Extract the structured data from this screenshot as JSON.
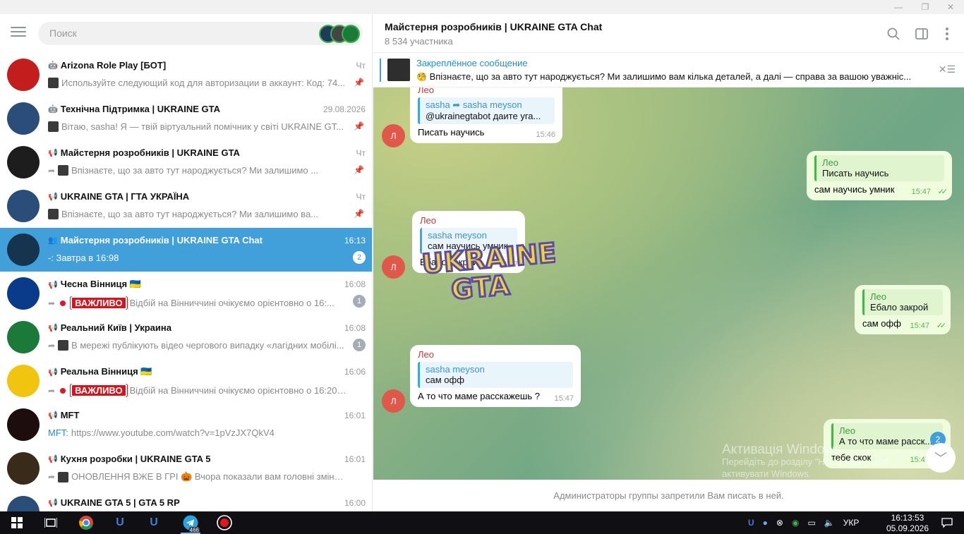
{
  "window": {
    "controls": {
      "minimize": "—",
      "maximize": "❐",
      "close": "✕"
    }
  },
  "sidebar": {
    "search_placeholder": "Поиск",
    "chats": [
      {
        "title": "Arizona Role Play [БОТ]",
        "kind": "bot",
        "time": "Чт",
        "preview": "Используйте следующий код для авторизации в аккаунт: Код: 74...",
        "pinned": true,
        "avatar_color": "#c31d1d"
      },
      {
        "title": "Технічна Підтримка | UKRAINE GTA",
        "kind": "bot",
        "time": "29.08.2026",
        "preview": "Вітаю, sasha! Я — твій віртуальний помічник у світі UKRAINE GT...",
        "pinned": true,
        "avatar_color": "#2a4d7a"
      },
      {
        "title": "Майстерня розробників | UKRAINE GTA",
        "kind": "channel",
        "time": "Чт",
        "preview": "Впізнаєте, що за авто тут народжується?  Ми залишимо ...",
        "pinned": true,
        "avatar_color": "#1d1d1d"
      },
      {
        "title": "UKRAINE GTA | ГТА УКРАЇНА",
        "kind": "channel",
        "time": "Чт",
        "preview": "Впізнаєте, що за авто тут народжується?  Ми залишимо ва...",
        "pinned": true,
        "avatar_color": "#2a4d7a"
      },
      {
        "title": "Майстерня розробників | UKRAINE GTA Chat",
        "kind": "group",
        "time": "16:13",
        "preview": "-: Завтра в 16:98",
        "badge": "2",
        "active": true,
        "avatar_color": "#17344f"
      },
      {
        "title": "Чесна Вінниця 🇺🇦",
        "kind": "channel",
        "time": "16:08",
        "tag": "ВАЖЛИВО",
        "preview": "Відбій на Вінниччині очікуємо орієнтовно о 16:...",
        "badge": "1",
        "avatar_color": "#0a3a8a"
      },
      {
        "title": "Реальний Київ | Украина",
        "kind": "channel",
        "time": "16:08",
        "preview": "В мережі публікують відео чергового випадку «лагідних мобілі...",
        "badge": "1",
        "avatar_color": "#1b7a3a"
      },
      {
        "title": "Реальна Вінниця 🇺🇦",
        "kind": "channel",
        "time": "16:06",
        "tag": "ВАЖЛИВО",
        "preview": "Відбій на Вінниччині очікуємо орієнтовно о 16:20 - 16:...",
        "avatar_color": "#f1c40f"
      },
      {
        "title": "MFT",
        "kind": "channel",
        "time": "16:01",
        "sender": "MFT:",
        "preview": "https://www.youtube.com/watch?v=1pVzJX7QkV4",
        "avatar_color": "#1d0d0d"
      },
      {
        "title": "Кухня розробки | UKRAINE GTA 5",
        "kind": "channel",
        "time": "16:01",
        "preview": "ОНОВЛЕННЯ ВЖЕ В ГРІ 🎃  Вчора показали вам головні зміни, а...",
        "avatar_color": "#3a2a1a"
      },
      {
        "title": "UKRAINE GTA 5 | GTA 5 RP",
        "kind": "channel",
        "time": "16:00",
        "preview": "",
        "avatar_color": "#2a4d7a"
      }
    ]
  },
  "header": {
    "title": "Майстерня розробників | UKRAINE GTA Chat",
    "subtitle": "8 534 участника"
  },
  "pinned": {
    "title": "Закреплённое сообщение",
    "text": "Впізнаєте, що за авто тут народжується?  Ми залишимо вам кілька деталей, а далі — справа за вашою уважніс..."
  },
  "messages": [
    {
      "dir": "in",
      "sender": "Лео",
      "reply_name": "sasha ➦ sasha meyson",
      "reply_text": "@ukrainegtabot  даите уга...",
      "text": "Писать научись",
      "time": "15:46"
    },
    {
      "dir": "out",
      "reply_name": "Лео",
      "reply_text": "Писать научись",
      "text": "сам научись умник",
      "time": "15:47"
    },
    {
      "dir": "in",
      "sender": "Лео",
      "reply_name": "sasha meyson",
      "reply_text": "сам научись умник",
      "text": "Ебало закрой",
      "time": "15:47"
    },
    {
      "dir": "out",
      "reply_name": "Лео",
      "reply_text": "Ебало закрой",
      "text": "сам офф",
      "time": "15:47"
    },
    {
      "dir": "in",
      "sender": "Лео",
      "reply_name": "sasha meyson",
      "reply_text": "сам офф",
      "text": "А то что маме расскажешь ?",
      "time": "15:47"
    },
    {
      "dir": "out",
      "reply_name": "Лео",
      "reply_text": "А то что маме расск...",
      "text": "тебе скок",
      "time": "15:47"
    }
  ],
  "avatar_letter": "Л",
  "scroll_badge": "2",
  "watermark": {
    "line1": "Активація Windows",
    "line2": "Перейдіть до розділу \"Настройки\", щоб",
    "line3": "активувати Windows."
  },
  "composer_notice": "Администраторы группы запретили Вам писать в ней.",
  "taskbar": {
    "telegram_badge": "466",
    "lang": "УКР",
    "time": "16:13:53",
    "date": "05.09.2026"
  },
  "colors": {
    "accent": "#419fd9",
    "out_bubble": "#effdde",
    "sender_red": "#c0393b"
  }
}
